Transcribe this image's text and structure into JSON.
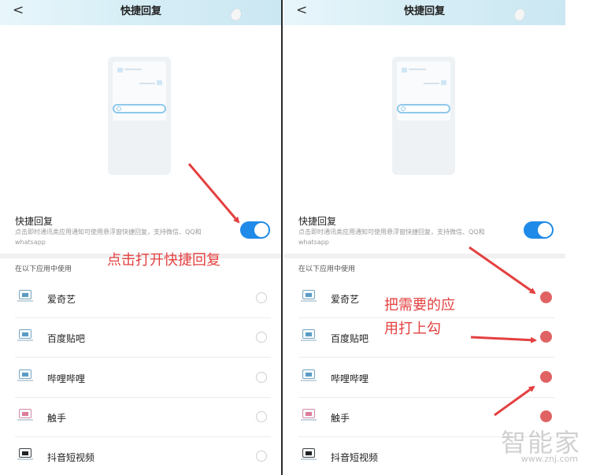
{
  "screens": [
    {
      "back_glyph": "<",
      "title": "快捷回复",
      "setting": {
        "label": "快捷回复",
        "description": "点击即时通讯类应用通知可使用悬浮窗快捷回复，支持微信、QQ和whatsapp",
        "enabled": true
      },
      "section_label": "在以下应用中使用",
      "apps": [
        {
          "name": "爱奇艺",
          "checked": false
        },
        {
          "name": "百度贴吧",
          "checked": false
        },
        {
          "name": "哔哩哔哩",
          "checked": false
        },
        {
          "name": "触手",
          "checked": false
        },
        {
          "name": "抖音短视频",
          "checked": false
        }
      ]
    },
    {
      "back_glyph": "<",
      "title": "快捷回复",
      "setting": {
        "label": "快捷回复",
        "description": "点击即时通讯类应用通知可使用悬浮窗快捷回复，支持微信、QQ和whatsapp",
        "enabled": true
      },
      "section_label": "在以下应用中使用",
      "apps": [
        {
          "name": "爱奇艺",
          "checked": true
        },
        {
          "name": "百度贴吧",
          "checked": true
        },
        {
          "name": "哔哩哔哩",
          "checked": true
        },
        {
          "name": "触手",
          "checked": true
        },
        {
          "name": "抖音短视频",
          "checked": false
        }
      ]
    }
  ],
  "annotations": {
    "left_text": "点击打开快捷回复",
    "right_text_line1": "把需要的应",
    "right_text_line2": "用打上勾",
    "color": "#e44040"
  },
  "watermark": {
    "text": "智能家",
    "sub": "www.znj.com"
  },
  "colors": {
    "accent_toggle": "#1f8ae8",
    "check_red": "#e06262",
    "header_bg": "#d7eef6"
  }
}
